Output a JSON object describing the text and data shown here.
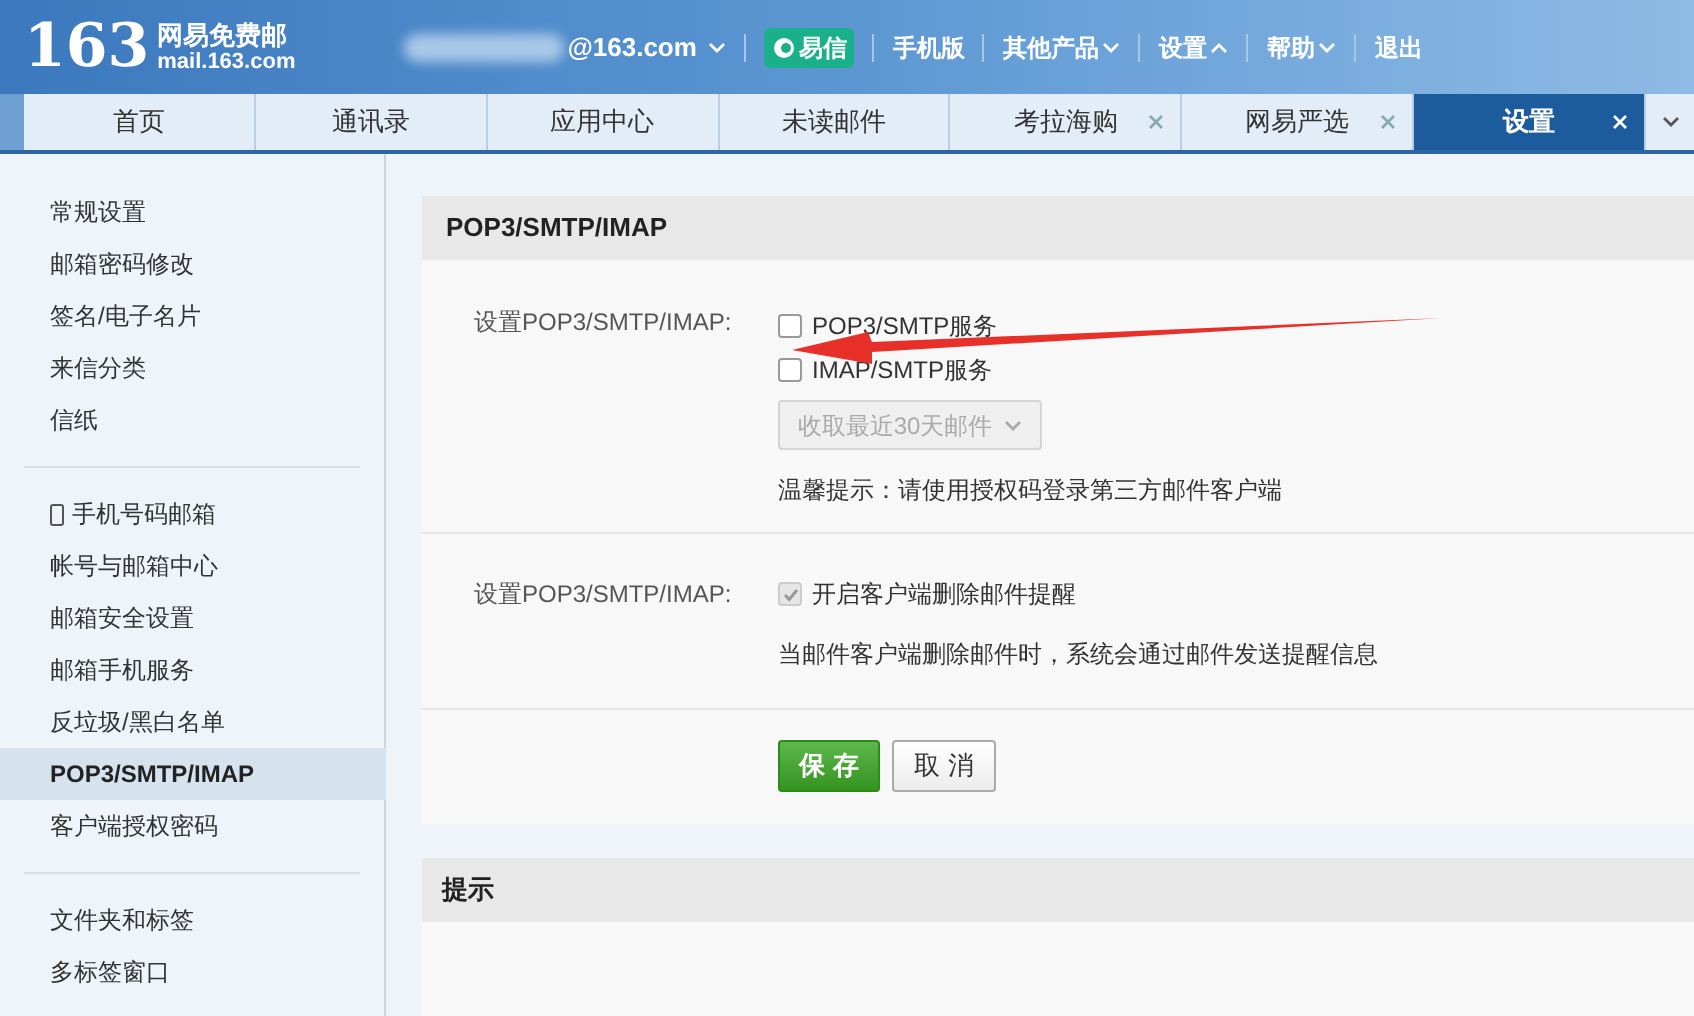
{
  "header": {
    "logo_number": "163",
    "logo_title": "网易免费邮",
    "logo_domain": "mail.163.com",
    "account": "@163.com",
    "links": [
      {
        "kind": "yixin",
        "label": "易信"
      },
      {
        "kind": "plain",
        "label": "手机版"
      },
      {
        "kind": "menu",
        "label": "其他产品",
        "expanded": false
      },
      {
        "kind": "menu",
        "label": "设置",
        "expanded": true
      },
      {
        "kind": "menu",
        "label": "帮助",
        "expanded": false
      },
      {
        "kind": "plain",
        "label": "退出"
      }
    ]
  },
  "tabs": [
    {
      "label": "首页",
      "selected": false,
      "closable": false
    },
    {
      "label": "通讯录",
      "selected": false,
      "closable": false
    },
    {
      "label": "应用中心",
      "selected": false,
      "closable": false
    },
    {
      "label": "未读邮件",
      "selected": false,
      "closable": false
    },
    {
      "label": "考拉海购",
      "selected": false,
      "closable": true
    },
    {
      "label": "网易严选",
      "selected": false,
      "closable": true
    },
    {
      "label": "设置",
      "selected": true,
      "closable": true
    }
  ],
  "sidebar": {
    "groups": [
      [
        {
          "label": "常规设置",
          "selected": false
        },
        {
          "label": "邮箱密码修改",
          "selected": false
        },
        {
          "label": "签名/电子名片",
          "selected": false
        },
        {
          "label": "来信分类",
          "selected": false
        },
        {
          "label": "信纸",
          "selected": false
        }
      ],
      [
        {
          "label": "手机号码邮箱",
          "selected": false,
          "phone_icon": true
        },
        {
          "label": "帐号与邮箱中心",
          "selected": false
        },
        {
          "label": "邮箱安全设置",
          "selected": false
        },
        {
          "label": "邮箱手机服务",
          "selected": false
        },
        {
          "label": "反垃圾/黑白名单",
          "selected": false
        },
        {
          "label": "POP3/SMTP/IMAP",
          "selected": true
        },
        {
          "label": "客户端授权密码",
          "selected": false
        }
      ],
      [
        {
          "label": "文件夹和标签",
          "selected": false
        },
        {
          "label": "多标签窗口",
          "selected": false
        }
      ]
    ]
  },
  "panel": {
    "title": "POP3/SMTP/IMAP",
    "section1": {
      "label": "设置POP3/SMTP/IMAP:",
      "options": [
        {
          "label": "POP3/SMTP服务",
          "checked": false,
          "disabled": false
        },
        {
          "label": "IMAP/SMTP服务",
          "checked": false,
          "disabled": false
        }
      ],
      "dropdown": {
        "value": "收取最近30天邮件",
        "disabled": true
      },
      "hint": "温馨提示：请使用授权码登录第三方邮件客户端"
    },
    "section2": {
      "label": "设置POP3/SMTP/IMAP:",
      "option": {
        "label": "开启客户端删除邮件提醒",
        "checked": true,
        "disabled": true
      },
      "note": "当邮件客户端删除邮件时，系统会通过邮件发送提醒信息"
    },
    "buttons": [
      {
        "kind": "primary",
        "label": "保 存"
      },
      {
        "kind": "secondary",
        "label": "取 消"
      }
    ]
  },
  "tips_panel": {
    "title": "提示"
  }
}
